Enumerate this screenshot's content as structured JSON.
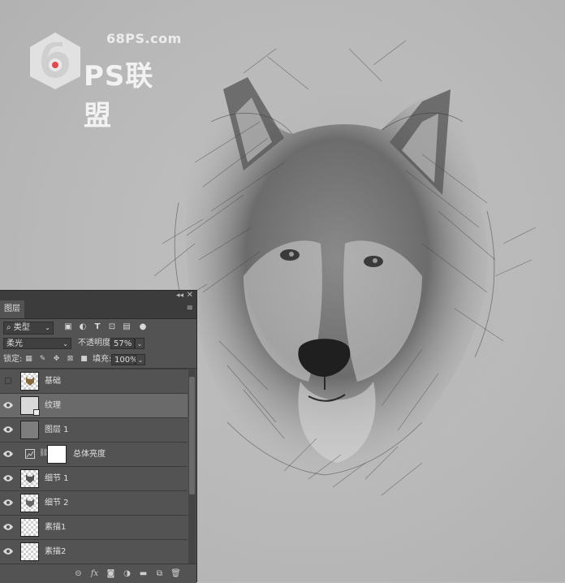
{
  "watermark": {
    "site": "68PS.com",
    "brand": "PS联盟"
  },
  "panel": {
    "title": "图层",
    "filter": {
      "kind_label": "类型"
    },
    "blend_mode": "柔光",
    "opacity_label": "不透明度:",
    "opacity_value": "57%",
    "lock_label": "锁定:",
    "fill_label": "填充:",
    "fill_value": "100%",
    "layers": [
      {
        "name": "基础",
        "visible": false,
        "selected": false
      },
      {
        "name": "纹理",
        "visible": true,
        "selected": true
      },
      {
        "name": "图层 1",
        "visible": true,
        "selected": false
      },
      {
        "name": "总体亮度",
        "visible": true,
        "selected": false
      },
      {
        "name": "细节 1",
        "visible": true,
        "selected": false
      },
      {
        "name": "细节 2",
        "visible": true,
        "selected": false
      },
      {
        "name": "素描1",
        "visible": true,
        "selected": false
      },
      {
        "name": "素描2",
        "visible": true,
        "selected": false
      }
    ]
  },
  "icons": {
    "eye": "eye-icon",
    "link": "link-icon",
    "fx": "fx-icon",
    "mask": "mask-icon",
    "adjustment": "adjustment-icon",
    "folder": "folder-icon",
    "new_layer": "new-layer-icon",
    "trash": "trash-icon"
  },
  "colors": {
    "panel_bg": "#535353",
    "selected_row": "#6a6a6a",
    "canvas_bg": "#b9b9b9"
  }
}
